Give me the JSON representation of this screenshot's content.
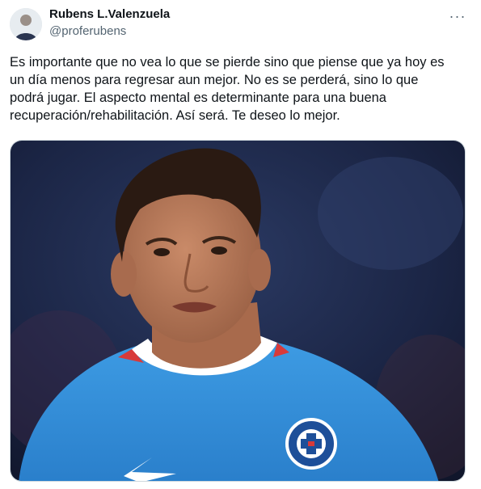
{
  "author": {
    "display_name": "Rubens L.Valenzuela",
    "handle": "@proferubens",
    "avatar_icon": "user-avatar-icon"
  },
  "menu": {
    "more_icon": "more-horizontal-icon",
    "more_glyph": "···"
  },
  "tweet": {
    "text_lines": [
      "Es importante que no vea lo que se pierde sino que piense que ya hoy es",
      "un día menos para regresar aun mejor. No es se perderá, sino lo que",
      "podrá jugar. El aspecto mental es determinante para una buena",
      "recuperación/rehabilitación.  Así será. Te deseo lo mejor."
    ]
  },
  "media": {
    "subject": "football-player-photo",
    "colors": {
      "jersey": "#2f8ad6",
      "background": "#1d2a4a",
      "skin": "#b97a5a",
      "hair": "#2a1a12"
    }
  }
}
